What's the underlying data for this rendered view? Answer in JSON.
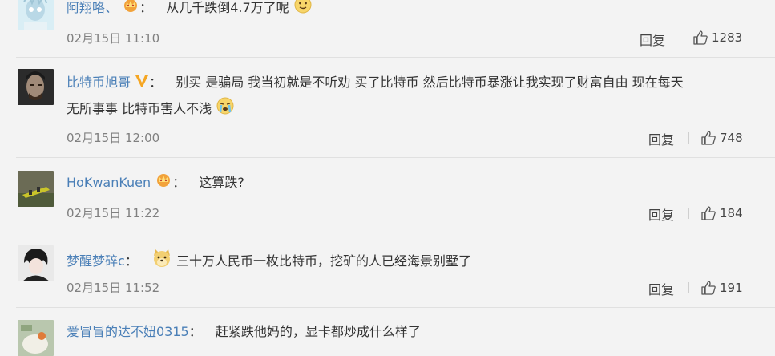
{
  "comments": [
    {
      "username": "阿翔咯、",
      "badge": "crown",
      "text": "从几千跌倒4.7万了呢",
      "emoji": "smile-emoji",
      "timestamp": "02月15日 11:10",
      "reply_label": "回复",
      "likes": "1283"
    },
    {
      "username": "比特币旭哥",
      "badge": "vip-v",
      "text": "别买 是骗局 我当初就是不听劝 买了比特币 然后比特币暴涨让我实现了财富自由 现在每天",
      "text_line2": "无所事事 比特币害人不浅",
      "emoji": "crying-emoji",
      "timestamp": "02月15日 12:00",
      "reply_label": "回复",
      "likes": "748"
    },
    {
      "username": "HoKwanKuen",
      "badge": "crown",
      "text": "这算跌?",
      "timestamp": "02月15日 11:22",
      "reply_label": "回复",
      "likes": "184"
    },
    {
      "username": "梦醒梦碎c",
      "text": "三十万人民币一枚比特币，挖矿的人已经海景别墅了",
      "emoji": "doge-emoji",
      "timestamp": "02月15日 11:52",
      "reply_label": "回复",
      "likes": "191"
    },
    {
      "username": "爱冒冒的达不妞0315",
      "text": "赶紧跌他妈的，显卡都炒成什么样了"
    }
  ],
  "colors": {
    "username": "#4a7fb7",
    "background": "#f3f3f3",
    "timestamp": "#808080"
  }
}
